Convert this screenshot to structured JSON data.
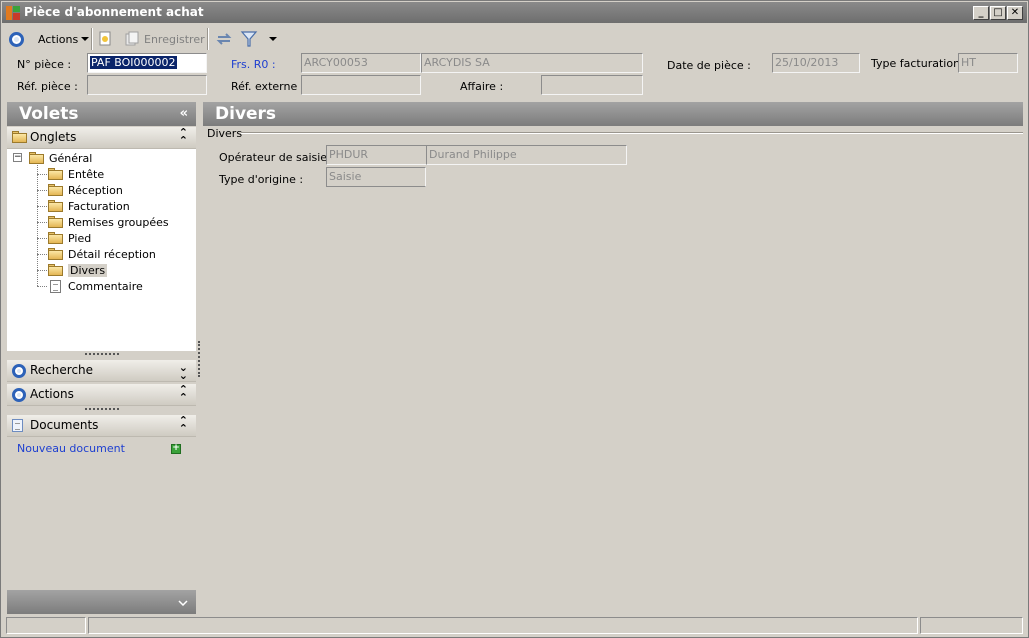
{
  "window": {
    "title": "Pièce d'abonnement achat",
    "controls": [
      "_",
      "□",
      "✕"
    ]
  },
  "toolbar": {
    "actions_label": "Actions",
    "save_label": "Enregistrer"
  },
  "header": {
    "num_piece_label": "N° pièce :",
    "num_piece_value": "PAF BOI000002",
    "frs_label": "Frs. R0 :",
    "frs_code": "ARCY00053",
    "frs_name": "ARCYDIS SA",
    "date_label": "Date de pièce :",
    "date_value": "25/10/2013",
    "type_fact_label": "Type facturation :",
    "type_fact_value": "HT",
    "ref_piece_label": "Réf. pièce :",
    "ref_piece_value": "",
    "ref_externe_label": "Réf. externe :",
    "ref_externe_value": "",
    "affaire_label": "Affaire :",
    "affaire_value": ""
  },
  "sidebar": {
    "title": "Volets",
    "collapse_glyph": "«",
    "onglets": {
      "title": "Onglets",
      "root": "Général",
      "items": [
        "Entête",
        "Réception",
        "Facturation",
        "Remises groupées",
        "Pied",
        "Détail réception",
        "Divers",
        "Commentaire"
      ],
      "selected": "Divers"
    },
    "recherche": {
      "title": "Recherche"
    },
    "actions": {
      "title": "Actions"
    },
    "documents": {
      "title": "Documents",
      "new_doc": "Nouveau document"
    }
  },
  "main": {
    "title": "Divers",
    "group_label": "Divers",
    "operateur_label": "Opérateur de saisie :",
    "operateur_code": "PHDUR",
    "operateur_name": "Durand Philippe",
    "type_origine_label": "Type d'origine :",
    "type_origine_value": "Saisie"
  },
  "colors": {
    "header_gradient": "#7c7c7c",
    "link_blue": "#1e3fd0",
    "selection": "#0a246a",
    "face": "#d4d0c8"
  }
}
